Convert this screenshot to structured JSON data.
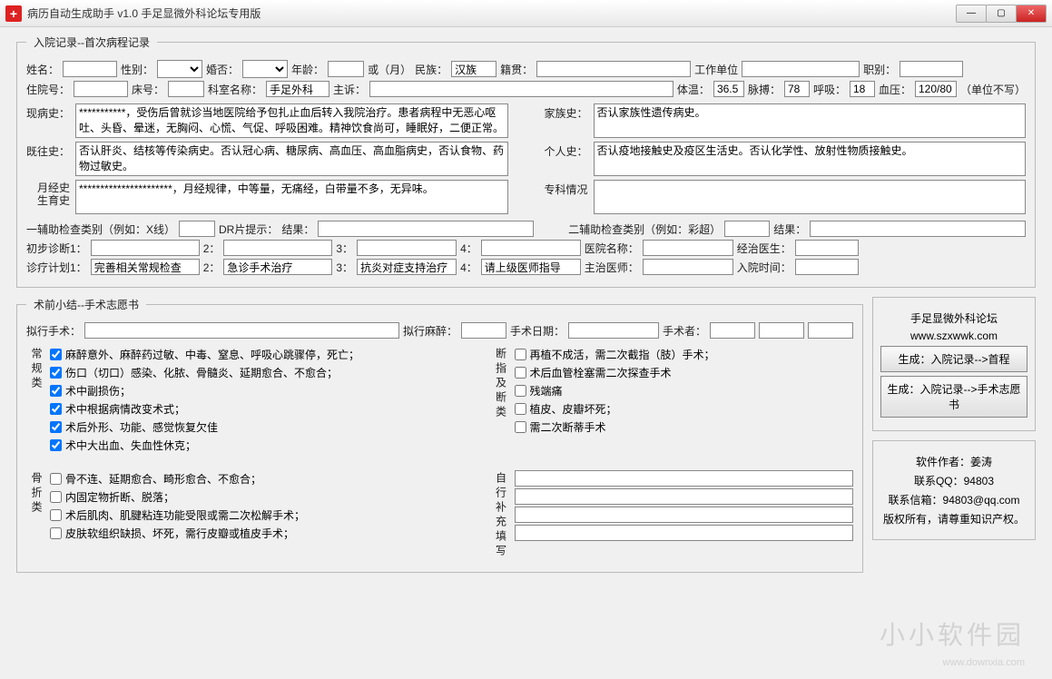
{
  "window": {
    "title": "病历自动生成助手 v1.0 手足显微外科论坛专用版"
  },
  "fs1": {
    "legend": "入院记录--首次病程记录",
    "r1": {
      "name_l": "姓名：",
      "sex_l": "性别：",
      "marry_l": "婚否：",
      "age_l": "年龄：",
      "or_month": "或（月）",
      "nation_l": "民族：",
      "nation_v": "汉族",
      "native_l": "籍贯：",
      "work_l": "工作单位",
      "job_l": "职别："
    },
    "r2": {
      "hospno_l": "住院号：",
      "bed_l": "床号：",
      "dept_l": "科室名称：",
      "dept_v": "手足外科",
      "chief_l": "主诉：",
      "temp_l": "体温：",
      "temp_v": "36.5",
      "pulse_l": "脉搏：",
      "pulse_v": "78",
      "breath_l": "呼吸：",
      "breath_v": "18",
      "bp_l": "血压：",
      "bp_v": "120/80",
      "unit": "（单位不写）"
    },
    "ta": {
      "presentl": "现病史：",
      "presentv": "***********，受伤后曾就诊当地医院给予包扎止血后转入我院治疗。患者病程中无恶心呕吐、头昏、晕迷，无胸闷、心慌、气促、呼吸困难。精神饮食尚可，睡眠好，二便正常。",
      "familyl": "家族史：",
      "familyv": "否认家族性遗传病史。",
      "pastl": "既往史：",
      "pastv": "否认肝炎、结核等传染病史。否认冠心病、糖尿病、高血压、高血脂病史，否认食物、药物过敏史。",
      "personall": "个人史：",
      "personalv": "否认疫地接触史及疫区生活史。否认化学性、放射性物质接触史。",
      "mensl": "月经史\n生育史",
      "mensv": "**********************，月经规律，中等量，无痛经，白带量不多，无异味。",
      "specl": "专科情况"
    },
    "aux": {
      "a1": "一辅助检查类别（例如：X线）",
      "dr": "DR片提示：",
      "res1": "结果：",
      "a2": "二辅助检查类别（例如：彩超）",
      "res2": "结果："
    },
    "diag": {
      "d1": "初步诊断1：",
      "n2": "2：",
      "n3": "3：",
      "n4": "4：",
      "hosp": "医院名称：",
      "doctor": "经治医生：",
      "plan": "诊疗计划1：",
      "p1": "完善相关常规检查",
      "p2": "急诊手术治疗",
      "p3": "抗炎对症支持治疗",
      "p4": "请上级医师指导",
      "attend": "主治医师：",
      "intime": "入院时间："
    }
  },
  "fs2": {
    "legend": "术前小结--手术志愿书",
    "r1": {
      "opl": "拟行手术：",
      "anesl": "拟行麻醉：",
      "datel": "手术日期：",
      "surgl": "手术者："
    },
    "grp1": {
      "title": "常规类",
      "c1": "麻醉意外、麻醉药过敏、中毒、窒息、呼吸心跳骤停，死亡；",
      "c2": "伤口（切口）感染、化脓、骨髓炎、延期愈合、不愈合；",
      "c3": "术中副损伤；",
      "c4": "术中根据病情改变术式；",
      "c5": "术后外形、功能、感觉恢复欠佳",
      "c6": "术中大出血、失血性休克；"
    },
    "grp2": {
      "title": "断指及断类",
      "c1": "再植不成活，需二次截指（肢）手术；",
      "c2": "术后血管栓塞需二次探查手术",
      "c3": "残端痛",
      "c4": "植皮、皮瓣坏死；",
      "c5": "需二次断蒂手术"
    },
    "grp3": {
      "title": "骨折类",
      "c1": "骨不连、延期愈合、畸形愈合、不愈合；",
      "c2": "内固定物折断、脱落；",
      "c3": "术后肌肉、肌腱粘连功能受限或需二次松解手术；",
      "c4": "皮肤软组织缺损、坏死，需行皮瓣或植皮手术；"
    },
    "grp4": {
      "title": "自行补充填写"
    }
  },
  "side": {
    "forum": "手足显微外科论坛",
    "url": "www.szxwwk.com",
    "btn1": "生成：入院记录-->首程",
    "btn2": "生成：入院记录-->手术志愿书",
    "author": "软件作者：姜涛",
    "qq": "联系QQ：94803",
    "site": "联系信箱：94803@qq.com",
    "copy": "版权所有，请尊重知识产权。"
  },
  "watermark": {
    "main": "小小软件园",
    "sub": "www.downxia.com"
  }
}
